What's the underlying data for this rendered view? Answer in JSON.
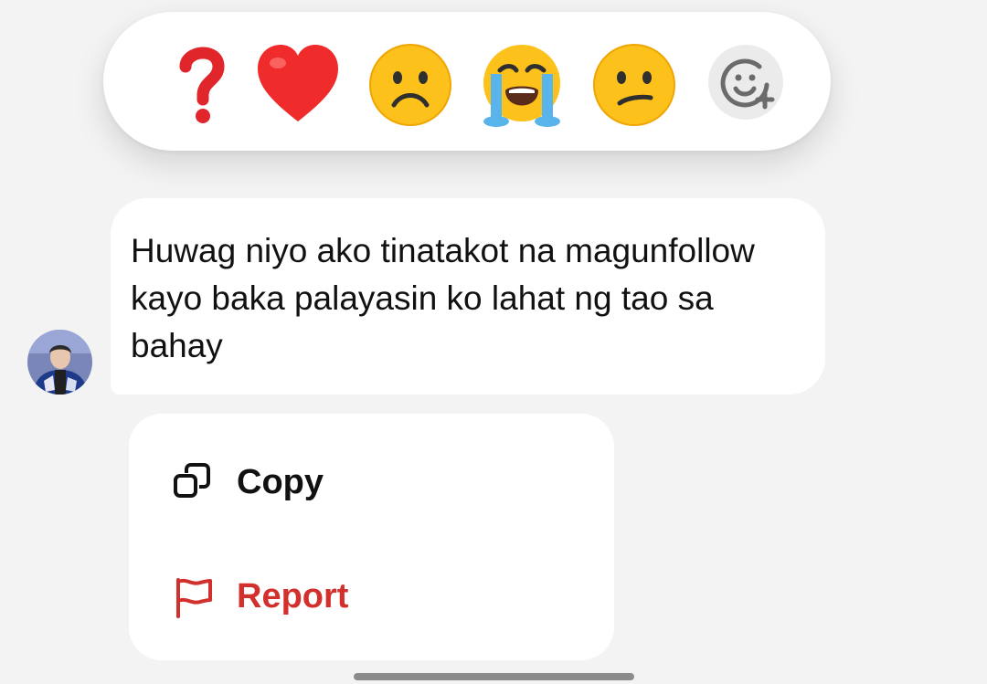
{
  "reactions": {
    "items": [
      {
        "name": "question-mark",
        "emoji": "❓"
      },
      {
        "name": "red-heart",
        "emoji": "❤️"
      },
      {
        "name": "frowning-face",
        "emoji": "☹️"
      },
      {
        "name": "loudly-crying-face",
        "emoji": "😭"
      },
      {
        "name": "confused-face",
        "emoji": "😕"
      }
    ],
    "more_icon": "add-reaction-icon"
  },
  "message": {
    "text": "Huwag niyo ako tinatakot na magunfollow kayo baka palayasin ko lahat ng tao sa bahay",
    "avatar_icon": "user-avatar"
  },
  "menu": {
    "copy": {
      "label": "Copy",
      "icon": "copy-icon",
      "color": "#111111"
    },
    "report": {
      "label": "Report",
      "icon": "flag-icon",
      "color": "#d2302c"
    }
  },
  "colors": {
    "background": "#f3f3f3",
    "surface": "#ffffff",
    "danger": "#d2302c"
  }
}
